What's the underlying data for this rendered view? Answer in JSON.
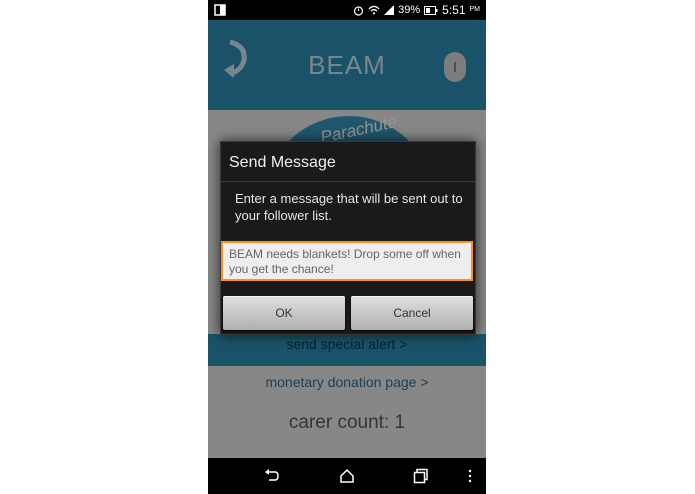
{
  "status_bar": {
    "battery_percent": "39%",
    "time": "5:51",
    "time_suffix": "PM",
    "icons": [
      "sim-icon",
      "alarm-icon",
      "wifi-icon",
      "signal-icon",
      "battery-icon"
    ]
  },
  "app": {
    "title": "BEAM",
    "back_icon": "back-arrow-icon",
    "info_icon": "info-icon",
    "logo_text": "Parachute"
  },
  "main": {
    "alert_link": "send special alert >",
    "donation_link": "monetary donation page >",
    "carer_count": "carer count: 1"
  },
  "dialog": {
    "title": "Send Message",
    "message": "Enter a message that will be sent out to your follower list.",
    "input_value": "BEAM needs blankets! Drop some off when you get the chance!",
    "ok_label": "OK",
    "cancel_label": "Cancel"
  },
  "nav": {
    "icons": [
      "back-icon",
      "home-icon",
      "recents-icon",
      "menu-icon"
    ]
  },
  "colors": {
    "accent": "#2e8fb5",
    "input_border": "#ff8f1f"
  }
}
